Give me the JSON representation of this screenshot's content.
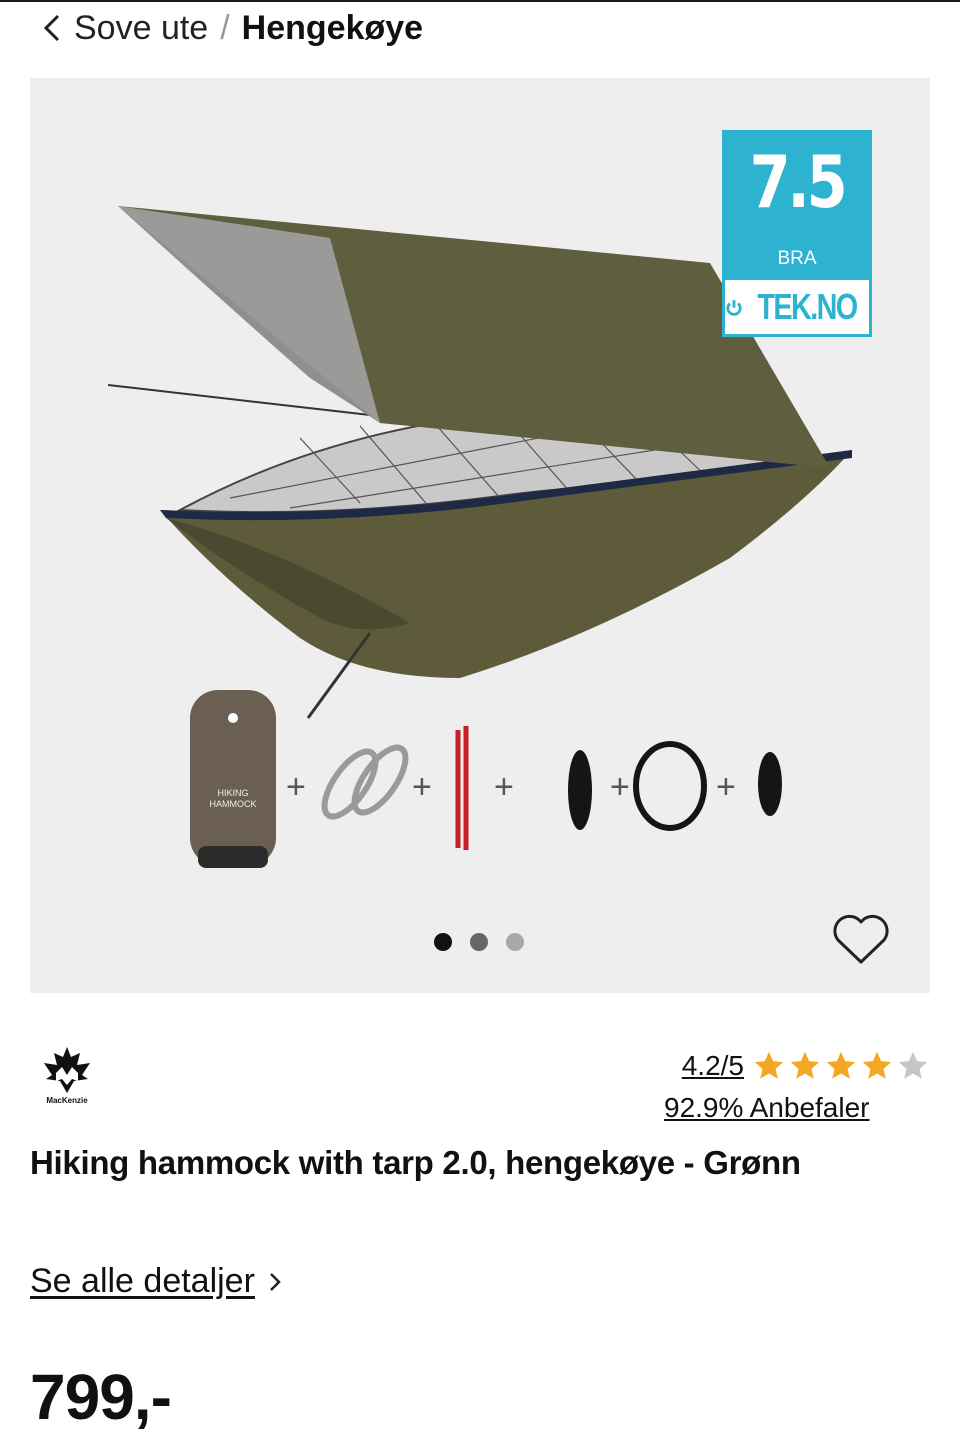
{
  "breadcrumb": {
    "parent": "Sove ute",
    "separator": "/",
    "current": "Hengekøye"
  },
  "gallery": {
    "photo_subject": "hammock-with-tarp-and-accessories",
    "pack_text": "HIKING HAMMOCK",
    "active_slide": 1,
    "slides": 3
  },
  "review_badge": {
    "score": "7.5",
    "verdict": "BRA",
    "source": "TEK.NO",
    "color": "#2db2cf"
  },
  "brand": {
    "name": "MacKenzie"
  },
  "rating": {
    "score_label": "4.2/5",
    "stars_filled": 4,
    "stars_total": 5,
    "star_color": "#f5a623",
    "recommend_label": "92.9% Anbefaler"
  },
  "product": {
    "title": "Hiking hammock with tarp 2.0, hengekøye - Grønn",
    "details_link": "Se alle detaljer",
    "price": "799,-"
  }
}
